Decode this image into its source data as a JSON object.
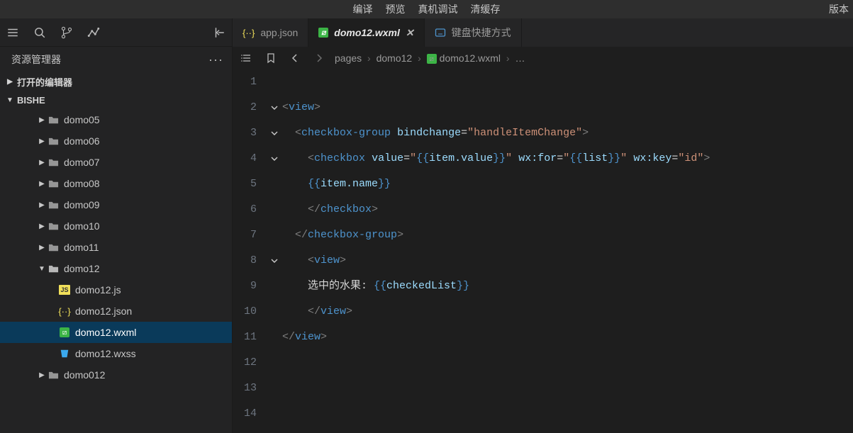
{
  "topmenu": {
    "items": [
      "编译",
      "预览",
      "真机调试",
      "清缓存"
    ],
    "right": "版本"
  },
  "explorer": {
    "title": "资源管理器",
    "sections": {
      "open_editors": "打开的编辑器",
      "project": "BISHE"
    }
  },
  "tree": [
    {
      "type": "folder",
      "name": "domo05",
      "depth": 2,
      "expanded": false
    },
    {
      "type": "folder",
      "name": "domo06",
      "depth": 2,
      "expanded": false
    },
    {
      "type": "folder",
      "name": "domo07",
      "depth": 2,
      "expanded": false
    },
    {
      "type": "folder",
      "name": "domo08",
      "depth": 2,
      "expanded": false
    },
    {
      "type": "folder",
      "name": "domo09",
      "depth": 2,
      "expanded": false
    },
    {
      "type": "folder",
      "name": "domo10",
      "depth": 2,
      "expanded": false
    },
    {
      "type": "folder",
      "name": "domo11",
      "depth": 2,
      "expanded": false
    },
    {
      "type": "folder",
      "name": "domo12",
      "depth": 2,
      "expanded": true
    },
    {
      "type": "file",
      "name": "domo12.js",
      "depth": 3,
      "icon": "js"
    },
    {
      "type": "file",
      "name": "domo12.json",
      "depth": 3,
      "icon": "json"
    },
    {
      "type": "file",
      "name": "domo12.wxml",
      "depth": 3,
      "icon": "wxml",
      "selected": true
    },
    {
      "type": "file",
      "name": "domo12.wxss",
      "depth": 3,
      "icon": "wxss"
    },
    {
      "type": "folder",
      "name": "domo012",
      "depth": 2,
      "expanded": false
    }
  ],
  "tabs": [
    {
      "label": "app.json",
      "icon": "json",
      "active": false,
      "closeable": false
    },
    {
      "label": "domo12.wxml",
      "icon": "wxml",
      "active": true,
      "closeable": true
    },
    {
      "label": "键盘快捷方式",
      "icon": "keyboard",
      "active": false,
      "closeable": false
    }
  ],
  "breadcrumb": {
    "parts": [
      "pages",
      "domo12",
      "domo12.wxml"
    ],
    "extra": "…"
  },
  "code": {
    "lines": [
      {
        "n": 1,
        "content": ""
      },
      {
        "n": 2,
        "fold": true,
        "content": "<view>"
      },
      {
        "n": 3,
        "fold": true,
        "content": "  <checkbox-group bindchange=\"handleItemChange\">"
      },
      {
        "n": 4,
        "fold": true,
        "content": "    <checkbox value=\"{{item.value}}\" wx:for=\"{{list}}\" wx:key=\"id\" >"
      },
      {
        "n": 5,
        "content": "    {{item.name}}"
      },
      {
        "n": 6,
        "content": "    </checkbox>"
      },
      {
        "n": 7,
        "content": "  </checkbox-group>"
      },
      {
        "n": 8,
        "fold": true,
        "content": "    <view>"
      },
      {
        "n": 9,
        "content": "    选中的水果: {{checkedList}}"
      },
      {
        "n": 10,
        "content": "    </view>"
      },
      {
        "n": 11,
        "content": "</view>"
      },
      {
        "n": 12,
        "content": ""
      },
      {
        "n": 13,
        "content": ""
      },
      {
        "n": 14,
        "content": ""
      }
    ]
  }
}
